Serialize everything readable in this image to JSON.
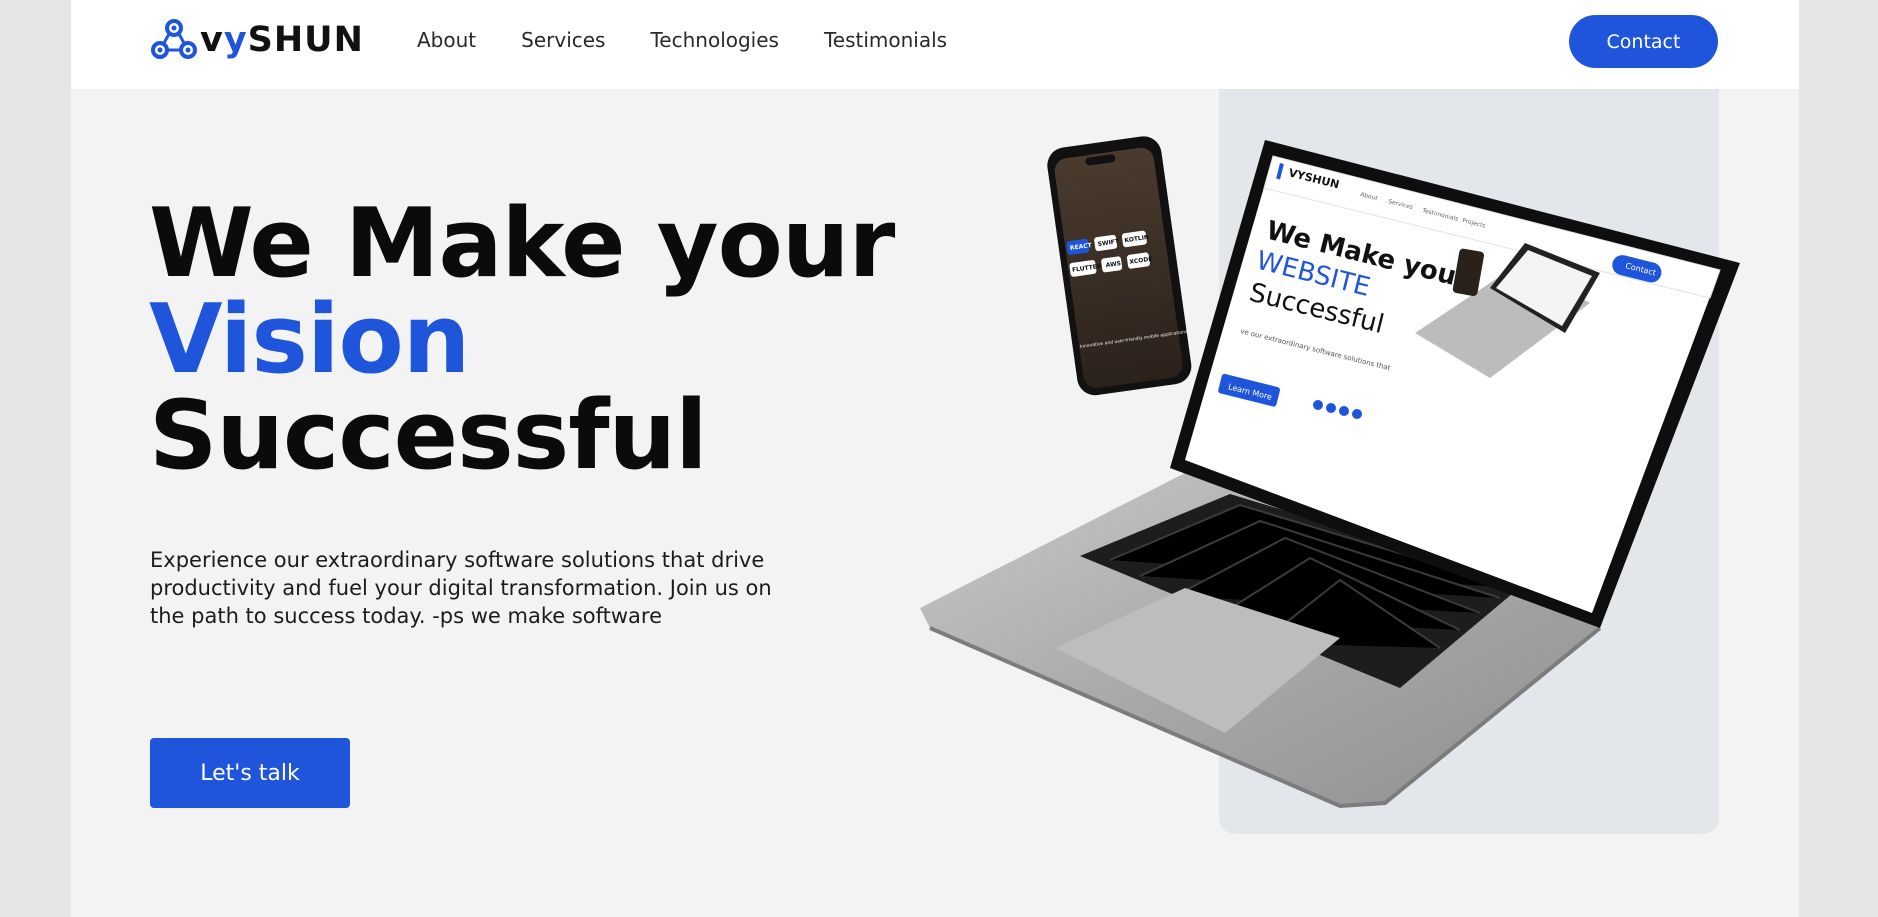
{
  "brand": {
    "name_prefix": "v",
    "name_accent": "y",
    "name_suffix": "SHUN",
    "accent_color": "#1f55db"
  },
  "nav": {
    "links": [
      {
        "label": "About"
      },
      {
        "label": "Services"
      },
      {
        "label": "Technologies"
      },
      {
        "label": "Testimonials"
      }
    ],
    "contact_label": "Contact"
  },
  "hero": {
    "title_line1": "We Make your",
    "title_accent": "Vision",
    "title_line3": "Successful",
    "description": "Experience our extraordinary software solutions that drive productivity and fuel your digital transformation. Join us on the path to success today. -ps we make software",
    "cta_label": "Let's talk"
  },
  "mockup_screen": {
    "logo": "VYSHUN",
    "nav": [
      "About",
      "Services",
      "Testimonials",
      "Projects"
    ],
    "contact": "Contact",
    "title_line1": "We Make your",
    "title_accent": "WEBSITE",
    "title_line3": "Successful",
    "body": "ve our extraordinary software solutions that",
    "cta": "Learn More",
    "phone_tags": [
      "REACT",
      "SWIFT",
      "KOTLIN",
      "FLUTTER",
      "AWS",
      "XCODE"
    ],
    "phone_caption": "Innovative and user-friendly mobile applications"
  }
}
